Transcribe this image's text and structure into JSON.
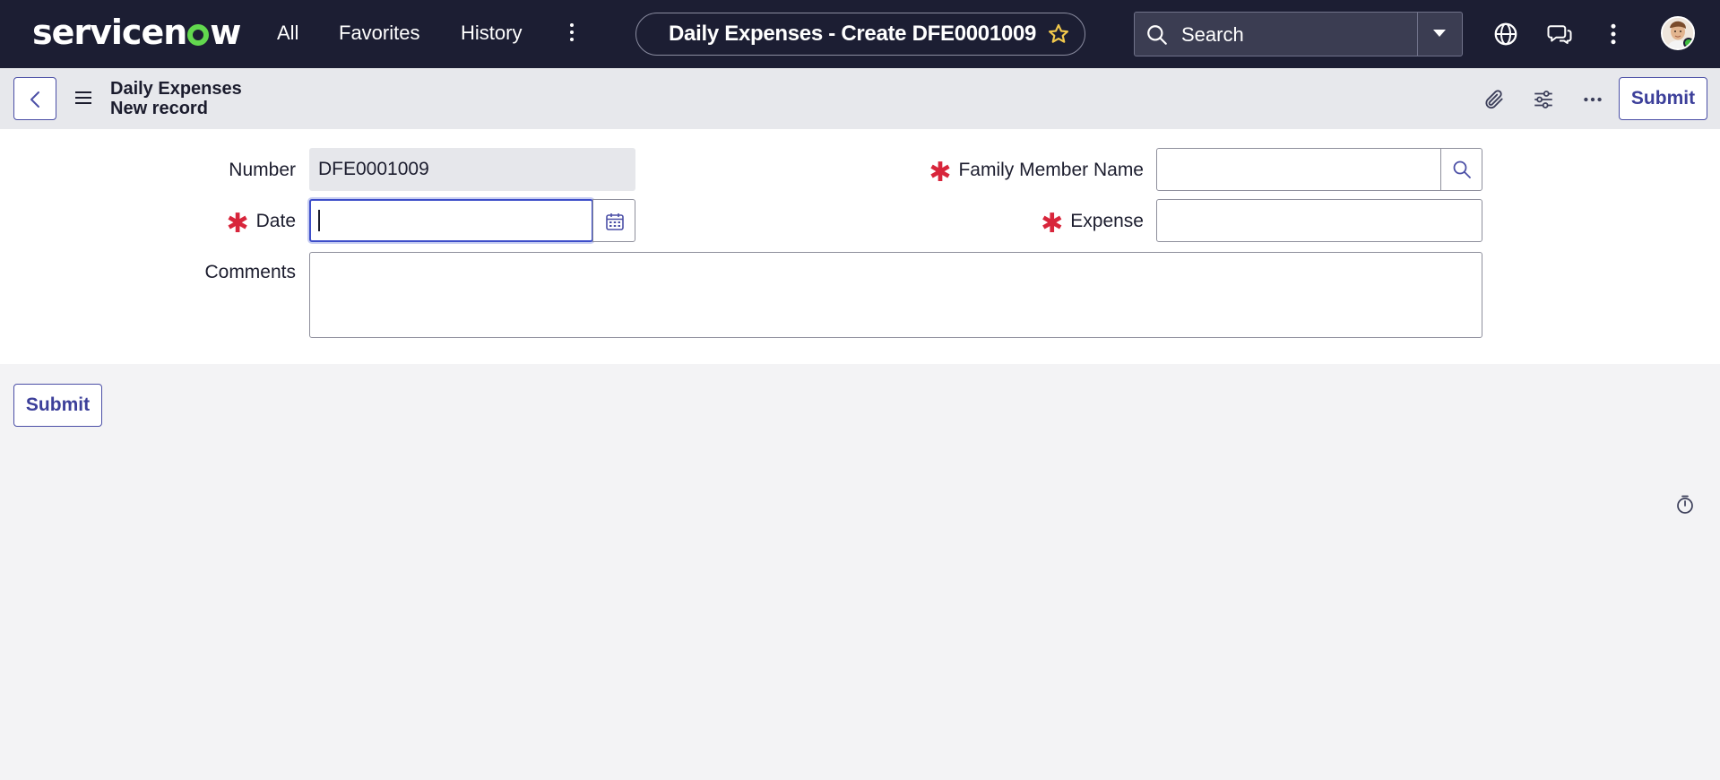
{
  "nav": {
    "logo_text_a": "servicen",
    "logo_text_b": "w",
    "all": "All",
    "favorites": "Favorites",
    "history": "History",
    "page_title": "Daily Expenses - Create DFE0001009",
    "search_label": "Search",
    "icons": [
      "more-vertical-icon",
      "star-icon",
      "search-icon",
      "chevron-down-icon",
      "globe-icon",
      "chat-icon",
      "more-vertical-icon",
      "user-avatar"
    ]
  },
  "header": {
    "table_name": "Daily Expenses",
    "record_label": "New record",
    "submit": "Submit",
    "icons": [
      "back-icon",
      "menu-icon",
      "paperclip-icon",
      "settings-sliders-icon",
      "more-horizontal-icon"
    ]
  },
  "form": {
    "number_label": "Number",
    "number_value": "DFE0001009",
    "date_label": "Date",
    "date_value": "",
    "family_member_label": "Family Member Name",
    "family_member_value": "",
    "expense_label": "Expense",
    "expense_value": "",
    "comments_label": "Comments",
    "comments_value": "",
    "required_mark": "✱"
  },
  "footer": {
    "submit": "Submit"
  },
  "colors": {
    "nav_bg": "#1c1e33",
    "accent": "#4b4fa6",
    "required": "#d8253b",
    "star": "#f2c94c",
    "online": "#3dbb3d"
  }
}
